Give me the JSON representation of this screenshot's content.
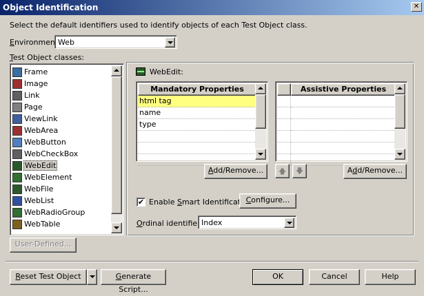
{
  "window": {
    "title": "Object Identification",
    "close_glyph": "✕"
  },
  "intro_text": "Select the default identifiers used to identify objects of each Test Object class.",
  "environment": {
    "label_pre": "",
    "label_u": "E",
    "label_post": "nvironment:",
    "value": "Web"
  },
  "classes_label_pre": "",
  "classes_label_u": "T",
  "classes_label_post": "est Object classes:",
  "classes": [
    {
      "label": "Frame",
      "icon": "frame-icon",
      "color": "#3a6ea5"
    },
    {
      "label": "Image",
      "icon": "image-icon",
      "color": "#a03030"
    },
    {
      "label": "Link",
      "icon": "link-icon",
      "color": "#606060"
    },
    {
      "label": "Page",
      "icon": "page-icon",
      "color": "#808080"
    },
    {
      "label": "ViewLink",
      "icon": "viewlink-icon",
      "color": "#4060a0"
    },
    {
      "label": "WebArea",
      "icon": "webarea-icon",
      "color": "#a03030"
    },
    {
      "label": "WebButton",
      "icon": "webbutton-icon",
      "color": "#5080c0"
    },
    {
      "label": "WebCheckBox",
      "icon": "webcheckbox-icon",
      "color": "#606060"
    },
    {
      "label": "WebEdit",
      "icon": "webedit-icon",
      "color": "#2a5a2a"
    },
    {
      "label": "WebElement",
      "icon": "webelement-icon",
      "color": "#307030"
    },
    {
      "label": "WebFile",
      "icon": "webfile-icon",
      "color": "#2a5a2a"
    },
    {
      "label": "WebList",
      "icon": "weblist-icon",
      "color": "#3050a0"
    },
    {
      "label": "WebRadioGroup",
      "icon": "webradiogroup-icon",
      "color": "#307030"
    },
    {
      "label": "WebTable",
      "icon": "webtable-icon",
      "color": "#806020"
    }
  ],
  "selected_index": 8,
  "user_defined_label": "User-Defined...",
  "panel_title": "WebEdit:",
  "mandatory": {
    "header": "Mandatory Properties",
    "rows": [
      "html tag",
      "name",
      "type",
      "",
      "",
      ""
    ],
    "highlight_color": "#ffff80"
  },
  "assistive": {
    "header": "Assistive Properties",
    "rows": [
      "",
      "",
      "",
      "",
      "",
      ""
    ]
  },
  "add_remove_label_pre": "",
  "add_remove_label_u": "A",
  "add_remove_label_post": "dd/Remove...",
  "add_remove2_label_pre": "A",
  "add_remove2_label_u": "d",
  "add_remove2_label_post": "d/Remove...",
  "up_glyph": "🡅",
  "down_glyph": "🡇",
  "smart_id": {
    "checked": true,
    "check_glyph": "✔",
    "label_pre": "Enable ",
    "label_u": "S",
    "label_post": "mart Identification",
    "configure_pre": "",
    "configure_u": "C",
    "configure_post": "onfigure..."
  },
  "ordinal": {
    "label_pre": "",
    "label_u": "O",
    "label_post": "rdinal identifier:",
    "value": "Index"
  },
  "footer": {
    "reset_pre": "",
    "reset_u": "R",
    "reset_post": "eset Test Object",
    "generate_pre": "",
    "generate_u": "G",
    "generate_post": "enerate Script...",
    "ok": "OK",
    "cancel": "Cancel",
    "help": "Help"
  }
}
